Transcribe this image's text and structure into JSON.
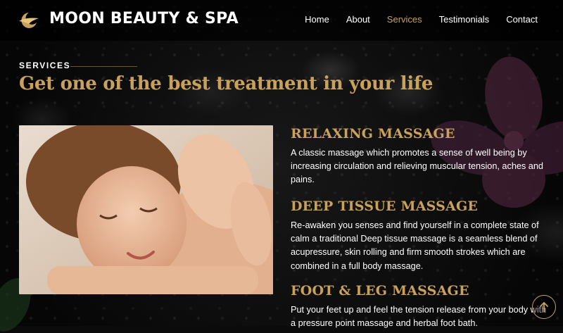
{
  "brand": {
    "name": "MOON BEAUTY & SPA",
    "logo_icon": "crescent-moon-bird-icon"
  },
  "nav": {
    "items": [
      {
        "label": "Home",
        "active": false
      },
      {
        "label": "About",
        "active": false
      },
      {
        "label": "Services",
        "active": true
      },
      {
        "label": "Testimonials",
        "active": false
      },
      {
        "label": "Contact",
        "active": false
      }
    ]
  },
  "section": {
    "eyebrow": "SERVICES",
    "headline": "Get one of the best treatment in your life"
  },
  "services": [
    {
      "title": "RELAXING MASSAGE",
      "description": "A classic massage which promotes a sense of well being by increasing circulation and relieving muscular tension, aches and pains."
    },
    {
      "title": "DEEP TISSUE MASSAGE",
      "description": "Re-awaken you senses and find yourself in a complete state of calm a traditional Deep tissue massage is a seamless blend of acupressure, skin rolling and firm smooth strokes which are combined in a full body massage."
    },
    {
      "title": "FOOT & LEG MASSAGE",
      "description": "Put your feet up and feel the tension release from your body with a pressure point massage and herbal foot bath."
    }
  ],
  "colors": {
    "accent": "#c9a15a",
    "background": "#0b0b0b",
    "header": "#000000"
  },
  "back_to_top_icon": "arrow-up-icon"
}
